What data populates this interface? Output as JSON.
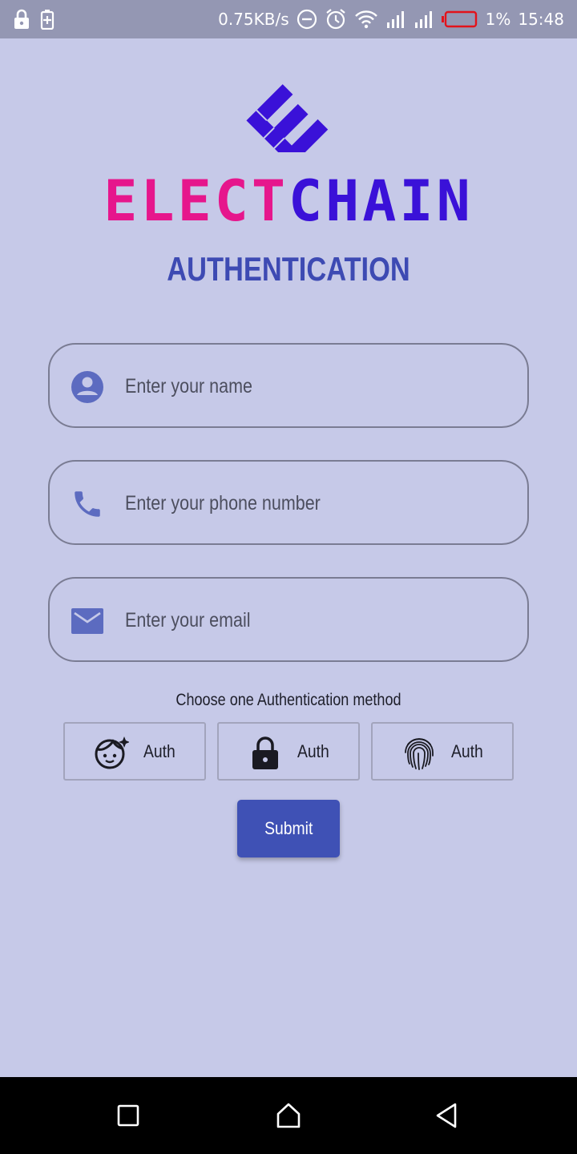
{
  "status_bar": {
    "network_speed": "0.75KB/s",
    "battery_percent": "1%",
    "time": "15:48",
    "icons": [
      "lock-icon",
      "battery-charging-icon",
      "do-not-disturb-icon",
      "alarm-icon",
      "wifi-icon",
      "signal-icon",
      "signal-icon",
      "battery-low-icon"
    ]
  },
  "app": {
    "logo_part1": "ELECT",
    "logo_part2": "CHAIN",
    "title": "AUTHENTICATION"
  },
  "form": {
    "name_placeholder": "Enter your name",
    "phone_placeholder": "Enter your phone number",
    "email_placeholder": "Enter your email",
    "choose_label": "Choose one Authentication method",
    "auth_options": [
      {
        "label": "Auth",
        "icon": "face-icon"
      },
      {
        "label": "Auth",
        "icon": "lock-icon"
      },
      {
        "label": "Auth",
        "icon": "fingerprint-icon"
      }
    ],
    "submit_label": "Submit"
  },
  "colors": {
    "background": "#c6c9e8",
    "accent": "#3f51b5",
    "title": "#3d4ab3",
    "logo_pink": "#e6168c",
    "logo_blue": "#3a11d8",
    "field_icon": "#5c6bc0"
  },
  "nav": {
    "icons": [
      "recents-icon",
      "home-icon",
      "back-icon"
    ]
  }
}
